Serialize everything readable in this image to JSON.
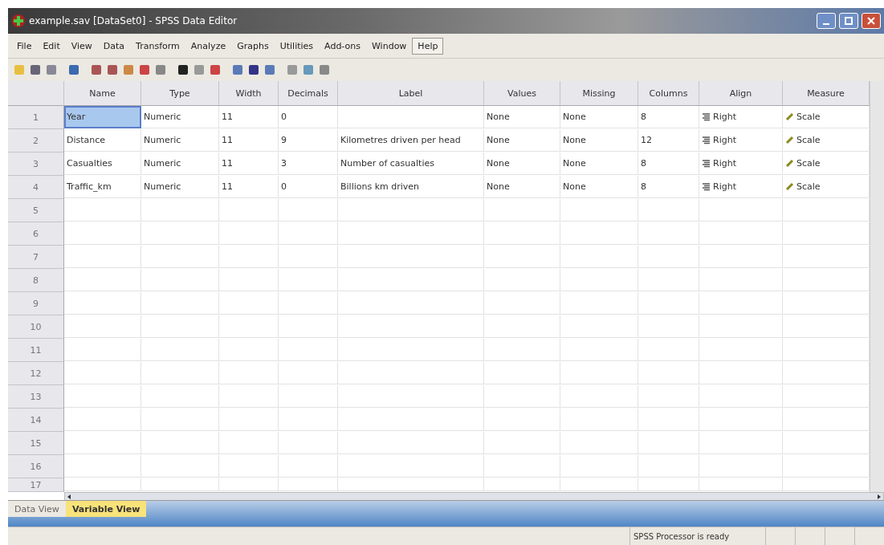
{
  "window": {
    "title": "example.sav [DataSet0] - SPSS Data Editor"
  },
  "menu": [
    {
      "label": "File",
      "highlighted": false
    },
    {
      "label": "Edit",
      "highlighted": false
    },
    {
      "label": "View",
      "highlighted": false
    },
    {
      "label": "Data",
      "highlighted": false
    },
    {
      "label": "Transform",
      "highlighted": false
    },
    {
      "label": "Analyze",
      "highlighted": false
    },
    {
      "label": "Graphs",
      "highlighted": false
    },
    {
      "label": "Utilities",
      "highlighted": false
    },
    {
      "label": "Add-ons",
      "highlighted": false
    },
    {
      "label": "Window",
      "highlighted": false
    },
    {
      "label": "Help",
      "highlighted": true
    }
  ],
  "table": {
    "columns": [
      "Name",
      "Type",
      "Width",
      "Decimals",
      "Label",
      "Values",
      "Missing",
      "Columns",
      "Align",
      "Measure"
    ],
    "rows": [
      {
        "number": "1",
        "name_selected": true,
        "cells": [
          "Year",
          "Numeric",
          "11",
          "0",
          "",
          "None",
          "None",
          "8",
          "Right",
          "Scale"
        ]
      },
      {
        "number": "2",
        "name_selected": false,
        "cells": [
          "Distance",
          "Numeric",
          "11",
          "9",
          "Kilometres driven per head",
          "None",
          "None",
          "12",
          "Right",
          "Scale"
        ]
      },
      {
        "number": "3",
        "name_selected": false,
        "cells": [
          "Casualties",
          "Numeric",
          "11",
          "3",
          "Number of casualties",
          "None",
          "None",
          "8",
          "Right",
          "Scale"
        ]
      },
      {
        "number": "4",
        "name_selected": false,
        "cells": [
          "Traffic_km",
          "Numeric",
          "11",
          "0",
          "Billions km driven",
          "None",
          "None",
          "8",
          "Right",
          "Scale"
        ]
      },
      {
        "number": "5",
        "name_selected": false,
        "cells": []
      },
      {
        "number": "6",
        "name_selected": false,
        "cells": []
      },
      {
        "number": "7",
        "name_selected": false,
        "cells": []
      },
      {
        "number": "8",
        "name_selected": false,
        "cells": []
      },
      {
        "number": "9",
        "name_selected": false,
        "cells": []
      },
      {
        "number": "10",
        "name_selected": false,
        "cells": []
      },
      {
        "number": "11",
        "name_selected": false,
        "cells": []
      },
      {
        "number": "12",
        "name_selected": false,
        "cells": []
      },
      {
        "number": "13",
        "name_selected": false,
        "cells": []
      },
      {
        "number": "14",
        "name_selected": false,
        "cells": []
      },
      {
        "number": "15",
        "name_selected": false,
        "cells": []
      },
      {
        "number": "16",
        "name_selected": false,
        "cells": []
      },
      {
        "number": "17",
        "name_selected": false,
        "cells": []
      }
    ]
  },
  "tabs": [
    {
      "label": "Data View",
      "selected": false
    },
    {
      "label": "Variable View",
      "selected": true
    }
  ],
  "status_bar": {
    "message": "SPSS Processor is ready"
  }
}
